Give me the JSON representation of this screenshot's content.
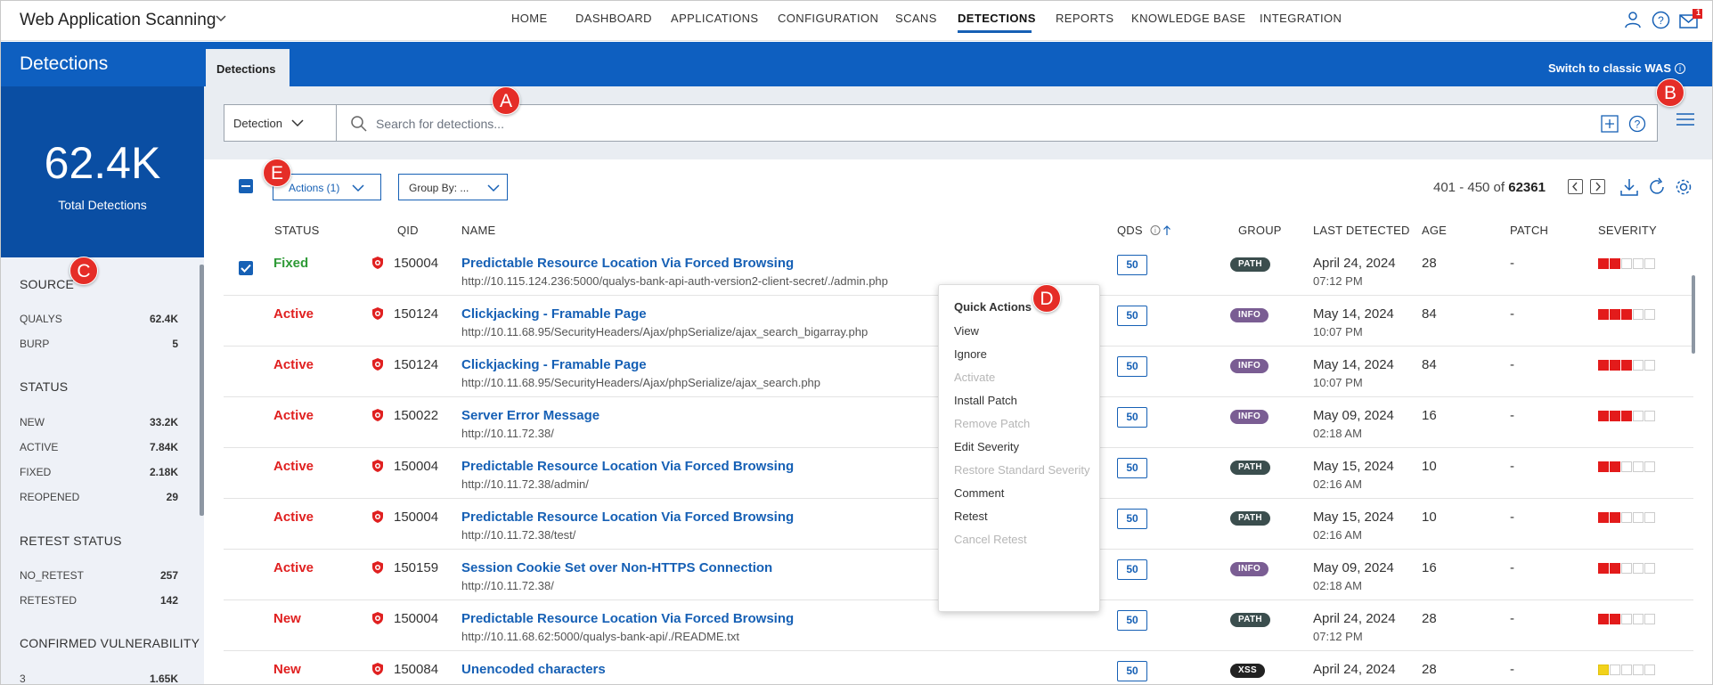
{
  "app": {
    "title": "Web Application Scanning"
  },
  "nav": {
    "items": [
      "HOME",
      "DASHBOARD",
      "APPLICATIONS",
      "CONFIGURATION",
      "SCANS",
      "DETECTIONS",
      "REPORTS",
      "KNOWLEDGE BASE",
      "INTEGRATION"
    ],
    "active": "DETECTIONS",
    "notification_count": "1"
  },
  "header": {
    "section_title": "Detections",
    "tab": "Detections",
    "switch_link": "Switch to classic WAS"
  },
  "kpi": {
    "value": "62.4K",
    "label": "Total Detections"
  },
  "facets": {
    "source": {
      "title": "SOURCE",
      "items": [
        {
          "label": "QUALYS",
          "value": "62.4K"
        },
        {
          "label": "BURP",
          "value": "5"
        }
      ]
    },
    "status": {
      "title": "STATUS",
      "items": [
        {
          "label": "NEW",
          "value": "33.2K"
        },
        {
          "label": "ACTIVE",
          "value": "7.84K"
        },
        {
          "label": "FIXED",
          "value": "2.18K"
        },
        {
          "label": "REOPENED",
          "value": "29"
        }
      ]
    },
    "retest": {
      "title": "RETEST STATUS",
      "items": [
        {
          "label": "NO_RETEST",
          "value": "257"
        },
        {
          "label": "RETESTED",
          "value": "142"
        }
      ]
    },
    "confirmed": {
      "title": "CONFIRMED VULNERABILITY",
      "items": [
        {
          "label": "3",
          "value": "1.65K"
        }
      ]
    }
  },
  "search": {
    "type": "Detection",
    "placeholder": "Search for detections..."
  },
  "toolbar": {
    "actions_label": "Actions (1)",
    "groupby_label": "Group By: ...",
    "range": "401 - 450 of",
    "total": "62361"
  },
  "columns": {
    "status": "STATUS",
    "qid": "QID",
    "name": "NAME",
    "qds": "QDS",
    "group": "GROUP",
    "last_detected": "LAST DETECTED",
    "age": "AGE",
    "patch": "PATCH",
    "severity": "SEVERITY"
  },
  "rows": [
    {
      "checked": true,
      "status": "Fixed",
      "qid": "150004",
      "name": "Predictable Resource Location Via Forced Browsing",
      "url": "http://10.115.124.236:5000/qualys-bank-api-auth-version2-client-secret/./admin.php",
      "qds": "50",
      "group": "PATH",
      "date": "April 24, 2024",
      "time": "07:12 PM",
      "age": "28",
      "patch": "-",
      "severity": 2,
      "sev_color": "red"
    },
    {
      "checked": false,
      "status": "Active",
      "qid": "150124",
      "name": "Clickjacking - Framable Page",
      "url": "http://10.11.68.95/SecurityHeaders/Ajax/phpSerialize/ajax_search_bigarray.php",
      "qds": "50",
      "group": "INFO",
      "date": "May 14, 2024",
      "time": "10:07 PM",
      "age": "84",
      "patch": "-",
      "severity": 3,
      "sev_color": "red"
    },
    {
      "checked": false,
      "status": "Active",
      "qid": "150124",
      "name": "Clickjacking - Framable Page",
      "url": "http://10.11.68.95/SecurityHeaders/Ajax/phpSerialize/ajax_search.php",
      "qds": "50",
      "group": "INFO",
      "date": "May 14, 2024",
      "time": "10:07 PM",
      "age": "84",
      "patch": "-",
      "severity": 3,
      "sev_color": "red"
    },
    {
      "checked": false,
      "status": "Active",
      "qid": "150022",
      "name": "Server Error Message",
      "url": "http://10.11.72.38/",
      "qds": "50",
      "group": "INFO",
      "date": "May 09, 2024",
      "time": "02:18 AM",
      "age": "16",
      "patch": "-",
      "severity": 3,
      "sev_color": "red"
    },
    {
      "checked": false,
      "status": "Active",
      "qid": "150004",
      "name": "Predictable Resource Location Via Forced Browsing",
      "url": "http://10.11.72.38/admin/",
      "qds": "50",
      "group": "PATH",
      "date": "May 15, 2024",
      "time": "02:16 AM",
      "age": "10",
      "patch": "-",
      "severity": 2,
      "sev_color": "red"
    },
    {
      "checked": false,
      "status": "Active",
      "qid": "150004",
      "name": "Predictable Resource Location Via Forced Browsing",
      "url": "http://10.11.72.38/test/",
      "qds": "50",
      "group": "PATH",
      "date": "May 15, 2024",
      "time": "02:16 AM",
      "age": "10",
      "patch": "-",
      "severity": 2,
      "sev_color": "red"
    },
    {
      "checked": false,
      "status": "Active",
      "qid": "150159",
      "name": "Session Cookie Set over Non-HTTPS Connection",
      "url": "http://10.11.72.38/",
      "qds": "50",
      "group": "INFO",
      "date": "May 09, 2024",
      "time": "02:18 AM",
      "age": "16",
      "patch": "-",
      "severity": 2,
      "sev_color": "red"
    },
    {
      "checked": false,
      "status": "New",
      "qid": "150004",
      "name": "Predictable Resource Location Via Forced Browsing",
      "url": "http://10.11.68.62:5000/qualys-bank-api/./README.txt",
      "qds": "50",
      "group": "PATH",
      "date": "April 24, 2024",
      "time": "07:12 PM",
      "age": "28",
      "patch": "-",
      "severity": 2,
      "sev_color": "red"
    },
    {
      "checked": false,
      "status": "New",
      "qid": "150084",
      "name": "Unencoded characters",
      "url": "",
      "qds": "50",
      "group": "XSS",
      "date": "April 24, 2024",
      "time": "",
      "age": "28",
      "patch": "-",
      "severity": 1,
      "sev_color": "yellow"
    }
  ],
  "quick_actions": {
    "title": "Quick Actions",
    "items": [
      {
        "label": "View",
        "enabled": true
      },
      {
        "label": "Ignore",
        "enabled": true
      },
      {
        "label": "Activate",
        "enabled": false
      },
      {
        "label": "Install Patch",
        "enabled": true
      },
      {
        "label": "Remove Patch",
        "enabled": false
      },
      {
        "label": "Edit Severity",
        "enabled": true
      },
      {
        "label": "Restore Standard Severity",
        "enabled": false
      },
      {
        "label": "Comment",
        "enabled": true
      },
      {
        "label": "Retest",
        "enabled": true
      },
      {
        "label": "Cancel Retest",
        "enabled": false
      }
    ]
  },
  "callouts": [
    "A",
    "B",
    "C",
    "D",
    "E"
  ]
}
